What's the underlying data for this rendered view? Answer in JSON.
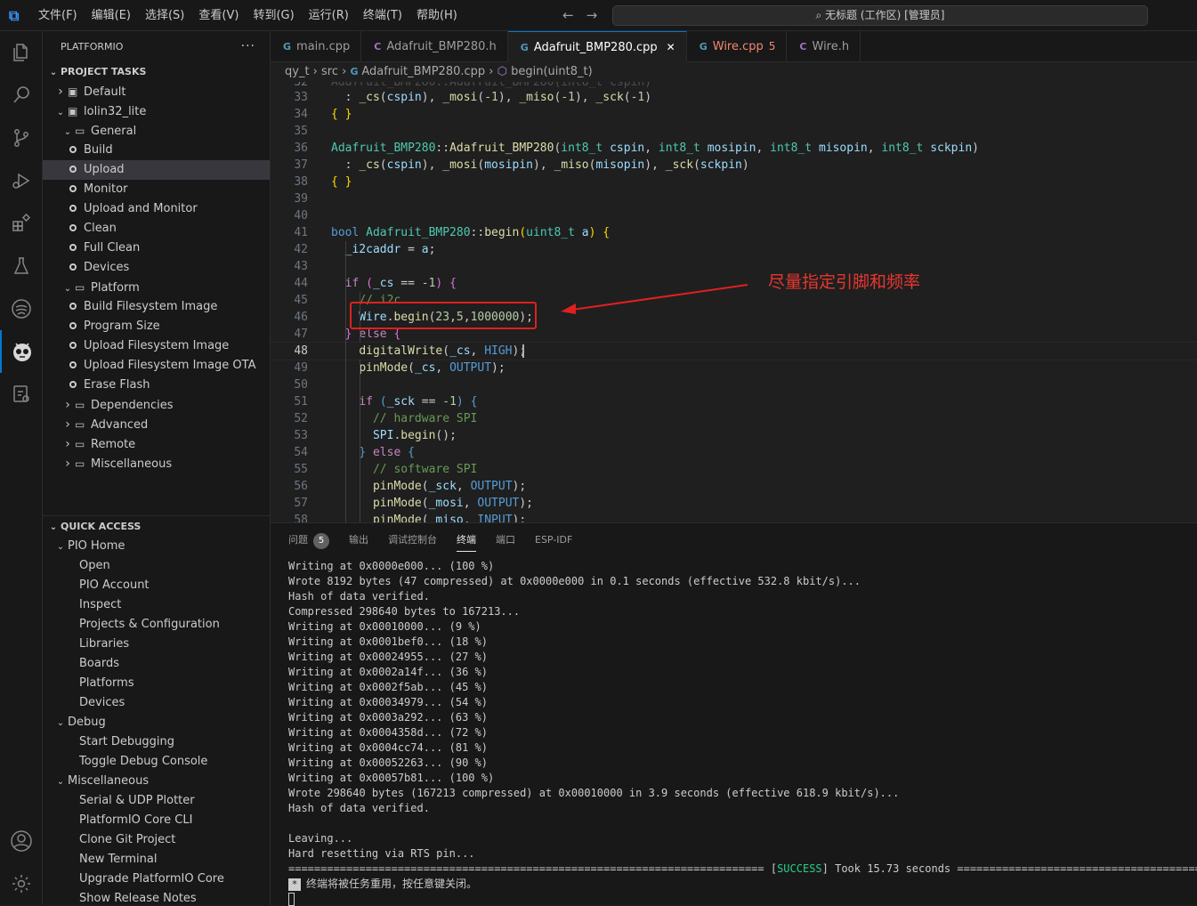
{
  "titlebar": {
    "menu": [
      "文件(F)",
      "编辑(E)",
      "选择(S)",
      "查看(V)",
      "转到(G)",
      "运行(R)",
      "终端(T)",
      "帮助(H)"
    ],
    "search_text": "无标题 (工作区) [管理员]"
  },
  "activity_bar": {
    "icons": [
      "explorer-icon",
      "search-icon",
      "source-control-icon",
      "run-debug-icon",
      "extensions-icon",
      "testing-icon",
      "remote-icon",
      "platformio-icon",
      "device-icon",
      "account-icon",
      "settings-icon"
    ]
  },
  "sidebar": {
    "title": "PLATFORMIO",
    "more": "···",
    "project_tasks": {
      "label": "PROJECT TASKS",
      "items": [
        {
          "label": "Default",
          "depth": 1,
          "kind": "folder-closed"
        },
        {
          "label": "lolin32_lite",
          "depth": 1,
          "kind": "folder-open"
        },
        {
          "label": "General",
          "depth": 2,
          "kind": "group-open"
        },
        {
          "label": "Build",
          "depth": 3,
          "kind": "task"
        },
        {
          "label": "Upload",
          "depth": 3,
          "kind": "task",
          "selected": true
        },
        {
          "label": "Monitor",
          "depth": 3,
          "kind": "task"
        },
        {
          "label": "Upload and Monitor",
          "depth": 3,
          "kind": "task"
        },
        {
          "label": "Clean",
          "depth": 3,
          "kind": "task"
        },
        {
          "label": "Full Clean",
          "depth": 3,
          "kind": "task"
        },
        {
          "label": "Devices",
          "depth": 3,
          "kind": "task"
        },
        {
          "label": "Platform",
          "depth": 2,
          "kind": "group-open"
        },
        {
          "label": "Build Filesystem Image",
          "depth": 3,
          "kind": "task"
        },
        {
          "label": "Program Size",
          "depth": 3,
          "kind": "task"
        },
        {
          "label": "Upload Filesystem Image",
          "depth": 3,
          "kind": "task"
        },
        {
          "label": "Upload Filesystem Image OTA",
          "depth": 3,
          "kind": "task"
        },
        {
          "label": "Erase Flash",
          "depth": 3,
          "kind": "task"
        },
        {
          "label": "Dependencies",
          "depth": 2,
          "kind": "group-closed"
        },
        {
          "label": "Advanced",
          "depth": 2,
          "kind": "group-closed"
        },
        {
          "label": "Remote",
          "depth": 2,
          "kind": "group-closed"
        },
        {
          "label": "Miscellaneous",
          "depth": 2,
          "kind": "group-closed"
        }
      ]
    },
    "quick_access": {
      "label": "QUICK ACCESS",
      "items": [
        {
          "label": "PIO Home",
          "depth": 1,
          "kind": "group-open"
        },
        {
          "label": "Open",
          "depth": 2,
          "kind": "link"
        },
        {
          "label": "PIO Account",
          "depth": 2,
          "kind": "link"
        },
        {
          "label": "Inspect",
          "depth": 2,
          "kind": "link"
        },
        {
          "label": "Projects & Configuration",
          "depth": 2,
          "kind": "link"
        },
        {
          "label": "Libraries",
          "depth": 2,
          "kind": "link"
        },
        {
          "label": "Boards",
          "depth": 2,
          "kind": "link"
        },
        {
          "label": "Platforms",
          "depth": 2,
          "kind": "link"
        },
        {
          "label": "Devices",
          "depth": 2,
          "kind": "link"
        },
        {
          "label": "Debug",
          "depth": 1,
          "kind": "group-open"
        },
        {
          "label": "Start Debugging",
          "depth": 2,
          "kind": "link"
        },
        {
          "label": "Toggle Debug Console",
          "depth": 2,
          "kind": "link"
        },
        {
          "label": "Miscellaneous",
          "depth": 1,
          "kind": "group-open"
        },
        {
          "label": "Serial & UDP Plotter",
          "depth": 2,
          "kind": "link"
        },
        {
          "label": "PlatformIO Core CLI",
          "depth": 2,
          "kind": "link"
        },
        {
          "label": "Clone Git Project",
          "depth": 2,
          "kind": "link"
        },
        {
          "label": "New Terminal",
          "depth": 2,
          "kind": "link"
        },
        {
          "label": "Upgrade PlatformIO Core",
          "depth": 2,
          "kind": "link"
        },
        {
          "label": "Show Release Notes",
          "depth": 2,
          "kind": "link"
        }
      ]
    }
  },
  "tabs": [
    {
      "label": "main.cpp",
      "type": "cpp",
      "icon": "G",
      "active": false
    },
    {
      "label": "Adafruit_BMP280.h",
      "type": "h",
      "icon": "C",
      "active": false
    },
    {
      "label": "Adafruit_BMP280.cpp",
      "type": "cpp",
      "icon": "G",
      "active": true,
      "close": "✕"
    },
    {
      "label": "Wire.cpp",
      "type": "cpp",
      "icon": "G",
      "active": false,
      "problems": "5"
    },
    {
      "label": "Wire.h",
      "type": "h",
      "icon": "C",
      "active": false
    }
  ],
  "breadcrumb": [
    "qy_t",
    "src",
    "Adafruit_BMP280.cpp",
    "begin(uint8_t)"
  ],
  "editor": {
    "current_line": 48,
    "lines": [
      {
        "n": "33",
        "html": "  : <span class='f'>_cs</span>(<span class='v'>cspin</span>), <span class='f'>_mosi</span>(<span class='n'>-1</span>), <span class='f'>_miso</span>(<span class='n'>-1</span>), <span class='f'>_sck</span>(<span class='n'>-1</span>)"
      },
      {
        "n": "34",
        "html": "<span class='p'>{ }</span>"
      },
      {
        "n": "35",
        "html": ""
      },
      {
        "n": "36",
        "html": "<span class='t'>Adafruit_BMP280</span>::<span class='f'>Adafruit_BMP280</span>(<span class='t'>int8_t</span> <span class='v'>cspin</span>, <span class='t'>int8_t</span> <span class='v'>mosipin</span>, <span class='t'>int8_t</span> <span class='v'>misopin</span>, <span class='t'>int8_t</span> <span class='v'>sckpin</span>)"
      },
      {
        "n": "37",
        "html": "  : <span class='f'>_cs</span>(<span class='v'>cspin</span>), <span class='f'>_mosi</span>(<span class='v'>mosipin</span>), <span class='f'>_miso</span>(<span class='v'>misopin</span>), <span class='f'>_sck</span>(<span class='v'>sckpin</span>)"
      },
      {
        "n": "38",
        "html": "<span class='p'>{ }</span>"
      },
      {
        "n": "39",
        "html": ""
      },
      {
        "n": "40",
        "html": ""
      },
      {
        "n": "41",
        "html": "<span class='k'>bool</span> <span class='t'>Adafruit_BMP280</span>::<span class='f'>begin</span><span class='p'>(</span><span class='t'>uint8_t</span> <span class='v'>a</span><span class='p'>)</span> <span class='p'>{</span>"
      },
      {
        "n": "42",
        "html": "  <span class='v'>_i2caddr</span> = <span class='v'>a</span>;"
      },
      {
        "n": "43",
        "html": ""
      },
      {
        "n": "44",
        "html": "  <span class='kc'>if</span> <span class='pp'>(</span><span class='v'>_cs</span> == <span class='n'>-1</span><span class='pp'>)</span> <span class='pp'>{</span>"
      },
      {
        "n": "45",
        "html": "    <span class='c'>// i2c</span>"
      },
      {
        "n": "46",
        "html": "    <span class='v'>Wire</span>.<span class='f'>begin</span>(<span class='n'>23</span>,<span class='n'>5</span>,<span class='n'>1000000</span>);"
      },
      {
        "n": "47",
        "html": "  <span class='pp'>}</span> <span class='kc'>else</span> <span class='pp'>{</span>"
      },
      {
        "n": "48",
        "html": "    <span class='f'>digitalWrite</span>(<span class='v'>_cs</span>, <span class='m'>HIGH</span>);"
      },
      {
        "n": "49",
        "html": "    <span class='f'>pinMode</span>(<span class='v'>_cs</span>, <span class='m'>OUTPUT</span>);"
      },
      {
        "n": "50",
        "html": ""
      },
      {
        "n": "51",
        "html": "    <span class='kc'>if</span> <span class='m'>(</span><span class='v'>_sck</span> == <span class='n'>-1</span><span class='m'>)</span> <span class='m'>{</span>"
      },
      {
        "n": "52",
        "html": "      <span class='c'>// hardware SPI</span>"
      },
      {
        "n": "53",
        "html": "      <span class='v'>SPI</span>.<span class='f'>begin</span>();"
      },
      {
        "n": "54",
        "html": "    <span class='m'>}</span> <span class='kc'>else</span> <span class='m'>{</span>"
      },
      {
        "n": "55",
        "html": "      <span class='c'>// software SPI</span>"
      },
      {
        "n": "56",
        "html": "      <span class='f'>pinMode</span>(<span class='v'>_sck</span>, <span class='m'>OUTPUT</span>);"
      },
      {
        "n": "57",
        "html": "      <span class='f'>pinMode</span>(<span class='v'>_mosi</span>, <span class='m'>OUTPUT</span>);"
      },
      {
        "n": "58",
        "html": "      <span class='f'>pinMode</span>(<span class='v'>_miso</span>, <span class='m'>INPUT</span>);"
      }
    ]
  },
  "annotation": {
    "text": "尽量指定引脚和频率",
    "color": "#e0201f"
  },
  "panel": {
    "tabs": [
      {
        "label": "问题",
        "badge": "5"
      },
      {
        "label": "输出"
      },
      {
        "label": "调试控制台"
      },
      {
        "label": "终端",
        "active": true
      },
      {
        "label": "端口"
      },
      {
        "label": "ESP-IDF"
      }
    ],
    "terminal_lines": [
      "Writing at 0x0000e000... (100 %)",
      "Wrote 8192 bytes (47 compressed) at 0x0000e000 in 0.1 seconds (effective 532.8 kbit/s)...",
      "Hash of data verified.",
      "Compressed 298640 bytes to 167213...",
      "Writing at 0x00010000... (9 %)",
      "Writing at 0x0001bef0... (18 %)",
      "Writing at 0x00024955... (27 %)",
      "Writing at 0x0002a14f... (36 %)",
      "Writing at 0x0002f5ab... (45 %)",
      "Writing at 0x00034979... (54 %)",
      "Writing at 0x0003a292... (63 %)",
      "Writing at 0x0004358d... (72 %)",
      "Writing at 0x0004cc74... (81 %)",
      "Writing at 0x00052263... (90 %)",
      "Writing at 0x00057b81... (100 %)",
      "Wrote 298640 bytes (167213 compressed) at 0x00010000 in 3.9 seconds (effective 618.9 kbit/s)...",
      "Hash of data verified.",
      "",
      "Leaving...",
      "Hard resetting via RTS pin..."
    ],
    "result_prefix": "========================================================================== [",
    "result_status": "SUCCESS",
    "result_suffix": "] Took 15.73 seconds ==========================================================================",
    "task_marker": "*",
    "task_message": "终端将被任务重用，按任意键关闭。"
  }
}
